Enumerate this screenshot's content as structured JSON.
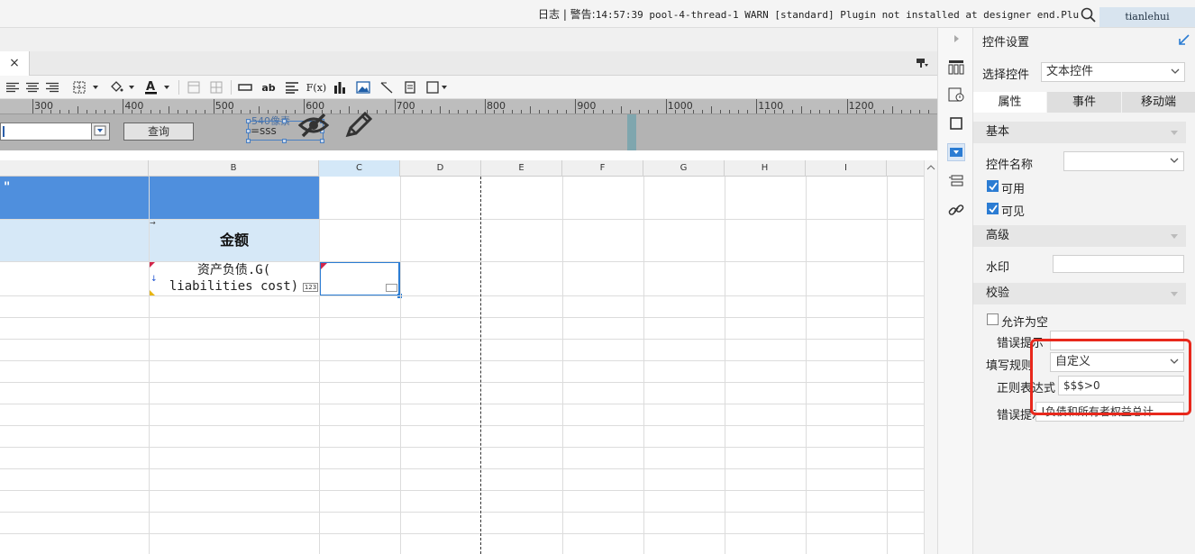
{
  "topbar": {
    "log_prefix": "日志 | 警告:",
    "log_message": "14:57:39 pool-4-thread-1 WARN [standard] Plugin not installed at designer end.Plugin ...",
    "user": "tianlehui"
  },
  "tab": {
    "close_label": "×"
  },
  "ruler": {
    "ticks": [
      "300",
      "400",
      "500",
      "600",
      "700",
      "800",
      "900",
      "1000",
      "1100",
      "1200"
    ]
  },
  "form": {
    "query_label": "查询",
    "hint_text": "540像素",
    "text_control_value": "=sss"
  },
  "sheet": {
    "columns": [
      "B",
      "C",
      "D",
      "E",
      "F",
      "G",
      "H",
      "I"
    ],
    "header_cell": "金额",
    "cell_line1": "资产负债.G(",
    "cell_line2": "liabilities cost)",
    "cell_badge": "123",
    "quote_mark": "\""
  },
  "panel": {
    "title": "控件设置",
    "select_control_label": "选择控件",
    "select_control_value": "文本控件",
    "tabs": [
      "属性",
      "事件",
      "移动端"
    ],
    "basic_section": "基本",
    "control_name_label": "控件名称",
    "control_name_value": "",
    "enabled_label": "可用",
    "visible_label": "可见",
    "advanced_section": "高级",
    "watermark_label": "水印",
    "watermark_value": "",
    "validation_section": "校验",
    "allow_empty_label": "允许为空",
    "error_tip_label_1": "错误提示",
    "error_tip_value_1": "",
    "fill_rule_label": "填写规则",
    "fill_rule_value": "自定义",
    "regex_label": "正则表达式",
    "regex_value": "$$$>0",
    "error_tip_label_2": "错误提示",
    "error_tip_value_2": "负债和所有者权益总计!"
  },
  "colors": {
    "selected_header": "#d4e8f8",
    "blue_row": "#4f8fdd",
    "light_row": "#d6e8f7",
    "accent": "#2b7cd3",
    "highlight": "#e8281c"
  }
}
